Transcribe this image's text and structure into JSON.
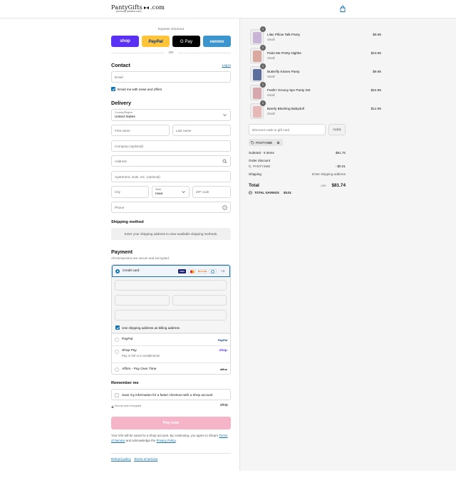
{
  "brand": {
    "name_main": "PantyGifts",
    "name_suffix": ".com",
    "tagline": "(formerly pantiesi.com)"
  },
  "express": {
    "title": "Express checkout",
    "shop": "shop",
    "paypal": "PayPal",
    "gpay": "G Pay",
    "venmo": "venmo",
    "or": "OR"
  },
  "contact": {
    "heading": "Contact",
    "login": "Log in",
    "email_placeholder": "Email",
    "news_label": "Email me with news and offers"
  },
  "delivery": {
    "heading": "Delivery",
    "country_label": "Country/Region",
    "country_value": "United States",
    "first_name": "First name",
    "last_name": "Last name",
    "company": "Company (optional)",
    "address": "Address",
    "apartment": "Apartment, suite, etc. (optional)",
    "city": "City",
    "state_label": "State",
    "state_value": "Iowa",
    "zip": "ZIP code",
    "phone": "Phone"
  },
  "shipping": {
    "heading": "Shipping method",
    "message": "Enter your shipping address to view available shipping methods."
  },
  "payment": {
    "heading": "Payment",
    "subtitle": "All transactions are secure and encrypted.",
    "credit_card": "Credit card",
    "card_brands": [
      "VISA",
      "MC",
      "DISCOVER",
      "AMEX"
    ],
    "more_cards": "+3",
    "billing_label": "Use shipping address as billing address",
    "paypal": "PayPal",
    "paypal_logo": "PayPal",
    "shop_pay": "Shop Pay",
    "shop_pay_sub": "Pay in full or in installments",
    "shop_logo": "shop",
    "affirm": "Affirm - Pay Over Time",
    "affirm_logo": "affirm"
  },
  "remember": {
    "heading": "Remember me",
    "label": "Save my information for a faster checkout with a Shop account",
    "secure": "Secure and encrypted",
    "shop_logo": "shop"
  },
  "pay_now": "Pay now",
  "legal": {
    "text1": "Your info will be saved to a Shop account. By continuing, you agree to Shop's ",
    "terms": "Terms of Service",
    "text2": " and acknowledge the ",
    "privacy": "Privacy Policy",
    "text3": "."
  },
  "footer": {
    "refund": "Refund policy",
    "terms": "Terms of service"
  },
  "cart": {
    "items": [
      {
        "name": "Lilac Pillow Talk Panty",
        "variant": "Small",
        "price": "$9.95",
        "qty": "1",
        "color": "#c9b3d6"
      },
      {
        "name": "Paint Me Pretty Nightie",
        "variant": "Small",
        "price": "$23.95",
        "qty": "1",
        "color": "#d9a9a0"
      },
      {
        "name": "Butterfly Kisses Panty",
        "variant": "Small",
        "price": "$9.95",
        "qty": "1",
        "color": "#5b6f9c"
      },
      {
        "name": "Feelin' Groovy 5pc Panty Set",
        "variant": "Small",
        "price": "$24.95",
        "qty": "1",
        "color": "#d8a6ad"
      },
      {
        "name": "Barely Blushing Babydoll",
        "variant": "Small",
        "price": "$12.95",
        "qty": "1",
        "color": "#e7b9b6"
      }
    ],
    "discount_placeholder": "Discount code or gift card",
    "apply": "Apply",
    "code": "PANTY4ME",
    "subtotal_label": "Subtotal · 5 items",
    "subtotal": "$81.75",
    "order_discount_label": "Order discount",
    "discount_code": "PANTY4ME",
    "discount_amount": "- $0.01",
    "shipping_label": "Shipping",
    "shipping_value": "Enter shipping address",
    "total_label": "Total",
    "currency": "USD",
    "total": "$81.74",
    "savings_label": "TOTAL SAVINGS",
    "savings": "$0.01"
  },
  "colors": {
    "accent": "#1773b0",
    "shop_purple": "#5a31f4",
    "paypal_yellow": "#ffc439",
    "venmo_blue": "#3d95ce",
    "pay_now": "#f6b4c8"
  }
}
